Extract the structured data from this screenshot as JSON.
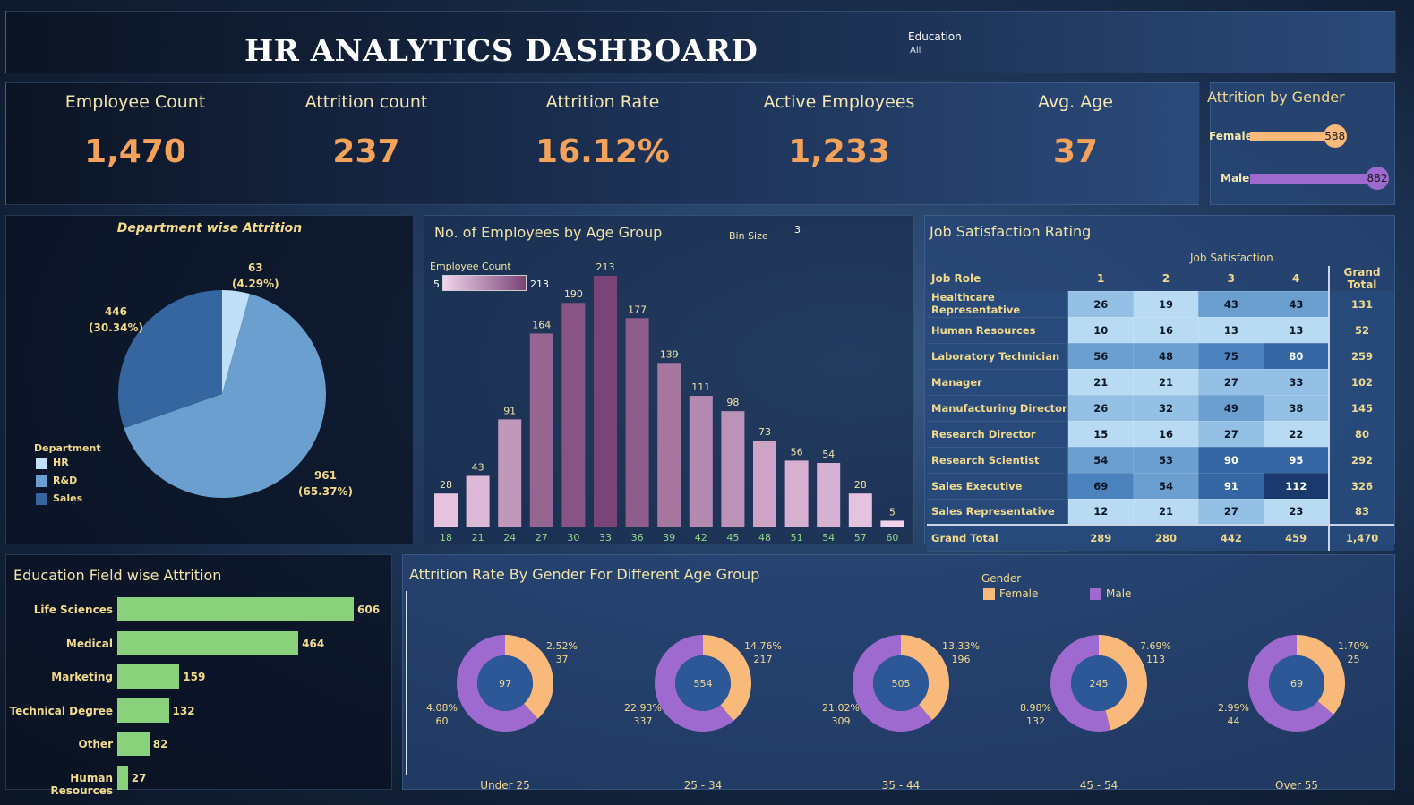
{
  "header": {
    "title": "HR ANALYTICS DASHBOARD",
    "filter_label": "Education",
    "filter_value": "All"
  },
  "kpis": [
    {
      "label": "Employee Count",
      "value": "1,470"
    },
    {
      "label": "Attrition count",
      "value": "237"
    },
    {
      "label": "Attrition Rate",
      "value": "16.12%"
    },
    {
      "label": "Active Employees",
      "value": "1,233"
    },
    {
      "label": "Avg. Age",
      "value": "37"
    }
  ],
  "gender_attrition": {
    "title": "Attrition by Gender",
    "items": [
      {
        "label": "Female",
        "value": 588,
        "color": "#f9b97a"
      },
      {
        "label": "Male",
        "value": 882,
        "color": "#9e6ad0"
      }
    ]
  },
  "department": {
    "title": "Department wise Attrition",
    "legend_title": "Department",
    "slices": [
      {
        "name": "HR",
        "value": 63,
        "percent": "(4.29%)",
        "color": "#bfe0f6"
      },
      {
        "name": "R&D",
        "value": 961,
        "percent": "(65.37%)",
        "color": "#6a9fcf"
      },
      {
        "name": "Sales",
        "value": 446,
        "percent": "(30.34%)",
        "color": "#3566a0"
      }
    ]
  },
  "age_group": {
    "title": "No. of Employees by Age Group",
    "bin_size_label": "Bin Size",
    "bin_size_value": "3",
    "legend_label": "Employee Count",
    "legend_min": "5",
    "legend_max": "213"
  },
  "job_satisfaction": {
    "title": "Job Satisfaction Rating",
    "group_header": "Job Satisfaction",
    "role_header": "Job Role",
    "columns": [
      "1",
      "2",
      "3",
      "4"
    ],
    "total_header": "Grand Total",
    "rows": [
      {
        "role": "Healthcare Representative",
        "values": [
          26,
          19,
          43,
          43
        ],
        "total": 131
      },
      {
        "role": "Human Resources",
        "values": [
          10,
          16,
          13,
          13
        ],
        "total": 52
      },
      {
        "role": "Laboratory Technician",
        "values": [
          56,
          48,
          75,
          80
        ],
        "total": 259
      },
      {
        "role": "Manager",
        "values": [
          21,
          21,
          27,
          33
        ],
        "total": 102
      },
      {
        "role": "Manufacturing Director",
        "values": [
          26,
          32,
          49,
          38
        ],
        "total": 145
      },
      {
        "role": "Research Director",
        "values": [
          15,
          16,
          27,
          22
        ],
        "total": 80
      },
      {
        "role": "Research Scientist",
        "values": [
          54,
          53,
          90,
          95
        ],
        "total": 292
      },
      {
        "role": "Sales Executive",
        "values": [
          69,
          54,
          91,
          112
        ],
        "total": 326
      },
      {
        "role": "Sales Representative",
        "values": [
          12,
          21,
          27,
          23
        ],
        "total": 83
      }
    ],
    "grand_total": {
      "role": "Grand Total",
      "values": [
        "289",
        "280",
        "442",
        "459"
      ],
      "total": "1,470"
    }
  },
  "education": {
    "title": "Education Field wise Attrition",
    "items": [
      {
        "label": "Life Sciences",
        "value": 606
      },
      {
        "label": "Medical",
        "value": 464
      },
      {
        "label": "Marketing",
        "value": 159
      },
      {
        "label": "Technical Degree",
        "value": 132
      },
      {
        "label": "Other",
        "value": 82
      },
      {
        "label": "Human Resources",
        "value": 27
      }
    ],
    "color": "#89d17a"
  },
  "age_gender": {
    "title": "Attrition Rate By Gender For Different Age Group",
    "legend_title": "Gender",
    "legend": [
      {
        "label": "Female",
        "color": "#f9b97a"
      },
      {
        "label": "Male",
        "color": "#9e6ad0"
      }
    ],
    "groups": [
      {
        "name": "Under 25",
        "total": "97",
        "female_pct": "2.52%",
        "female": 37,
        "male_pct": "4.08%",
        "male": 60
      },
      {
        "name": "25 - 34",
        "total": "554",
        "female_pct": "14.76%",
        "female": 217,
        "male_pct": "22.93%",
        "male": 337
      },
      {
        "name": "35 - 44",
        "total": "505",
        "female_pct": "13.33%",
        "female": 196,
        "male_pct": "21.02%",
        "male": 309
      },
      {
        "name": "45 - 54",
        "total": "245",
        "female_pct": "7.69%",
        "female": 113,
        "male_pct": "8.98%",
        "male": 132
      },
      {
        "name": "Over 55",
        "total": "69",
        "female_pct": "1.70%",
        "female": 25,
        "male_pct": "2.99%",
        "male": 44
      }
    ]
  },
  "chart_data": [
    {
      "type": "pie",
      "title": "Department wise Attrition",
      "categories": [
        "HR",
        "R&D",
        "Sales"
      ],
      "values": [
        63,
        961,
        446
      ]
    },
    {
      "type": "bar",
      "title": "No. of Employees by Age Group",
      "categories": [
        "18",
        "21",
        "24",
        "27",
        "30",
        "33",
        "36",
        "39",
        "42",
        "45",
        "48",
        "51",
        "54",
        "57",
        "60"
      ],
      "values": [
        28,
        43,
        91,
        164,
        190,
        213,
        177,
        139,
        111,
        98,
        73,
        56,
        54,
        28,
        5
      ],
      "color_min": "#f2d3ec",
      "color_max": "#7a4478"
    },
    {
      "type": "bar",
      "title": "Education Field wise Attrition",
      "categories": [
        "Life Sciences",
        "Medical",
        "Marketing",
        "Technical Degree",
        "Other",
        "Human Resources"
      ],
      "values": [
        606,
        464,
        159,
        132,
        82,
        27
      ]
    },
    {
      "type": "pie",
      "title": "Attrition Rate By Gender For Different Age Group",
      "categories": [
        "Under 25",
        "25 - 34",
        "35 - 44",
        "45 - 54",
        "Over 55"
      ],
      "series": [
        {
          "name": "Female",
          "values": [
            37,
            217,
            196,
            113,
            25
          ]
        },
        {
          "name": "Male",
          "values": [
            60,
            337,
            309,
            132,
            44
          ]
        }
      ]
    }
  ]
}
